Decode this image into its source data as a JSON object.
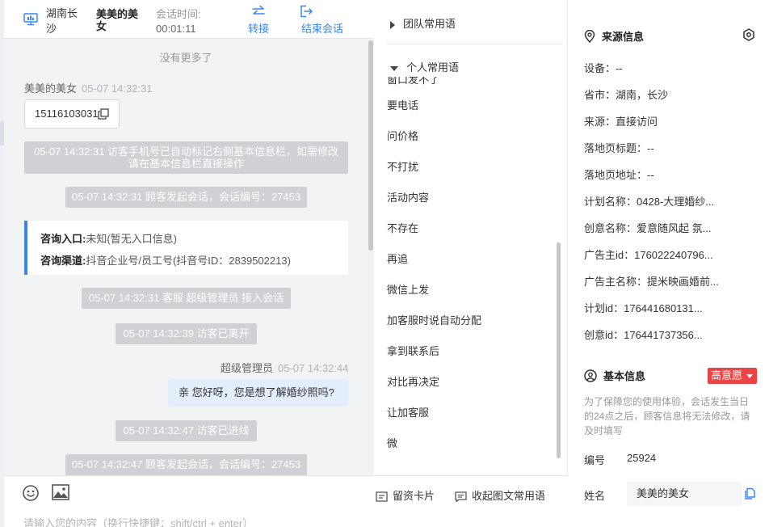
{
  "colors": {
    "accent": "#3a85f0",
    "badge": "#e84646",
    "system_msg_bg": "#cfd1d5",
    "chat_bg": "#f2f3f5"
  },
  "header": {
    "location": "湖南长沙",
    "visitor_name": "美美的美女",
    "session_time_label": "会话时间:",
    "session_time_value": "00:01:11",
    "transfer_label": "转接",
    "end_label": "结束会话"
  },
  "messages": {
    "no_more": "没有更多了",
    "visitor_name": "美美的美女",
    "visitor_time": "05-07 14:32:31",
    "phone": "15116103031",
    "sys_phone_mark_line1": "05-07 14:32:31 访客手机号已自动标记右侧基本信息栏，如需修改",
    "sys_phone_mark_line2": "请在基本信息栏直接操作",
    "sys_session_start_1": "05-07 14:32:31 顾客发起会话，会话编号：27453",
    "entry_label": "咨询入口:",
    "entry_value": "未知(暂无入口信息)",
    "channel_label": "咨询渠道:",
    "channel_value": "抖音企业号/员工号(抖音号ID：2839502213)",
    "sys_agent_join": "05-07 14:32:31 客服 超级管理员 接入会话",
    "sys_visitor_left": "05-07 14:32:39 访客已离开",
    "agent_name": "超级管理员",
    "agent_time": "05-07 14:32:44",
    "agent_message": "亲 您好呀，您是想了解婚纱照吗?",
    "sys_visitor_enter": "05-07 14:32:47 访客已进线",
    "sys_session_start_2": "05-07 14:32:47 顾客发起会话，会话编号：27453"
  },
  "composer": {
    "placeholder": "请输入您的内容（换行快捷键：shift/ctrl + enter）",
    "card_tool": "留资卡片",
    "fav_tool": "收起图文常用语"
  },
  "phrases": {
    "team_group": "团队常用语",
    "personal_group": "个人常用语",
    "clipped_item": "窗口发不了",
    "items": [
      "要电话",
      "问价格",
      "不打扰",
      "活动内容",
      "不存在",
      "再追",
      "微信上发",
      "加客服时说自动分配",
      "拿到联系后",
      "对比再决定",
      "让加客服",
      "微"
    ]
  },
  "source_info": {
    "title": "来源信息",
    "rows": [
      "设备：--",
      "省市：湖南，长沙",
      "来源：直接访问",
      "落地页标题：--",
      "落地页地址：--",
      "计划名称：0428-大理婚纱...",
      "创意名称：爱意随风起 氛...",
      "广告主id：176022240796...",
      "广告主名称：提米映画婚前...",
      "计划id：176441680131...",
      "创意id：176441737356..."
    ]
  },
  "basic_info": {
    "title": "基本信息",
    "intent_badge": "高意愿",
    "notice": "为了保障您的使用体验，会话发生当日的24点之后，顾客信息将无法修改，请及时填写",
    "id_label": "编号",
    "id_value": "25924",
    "name_label": "姓名",
    "name_value": "美美的美女"
  }
}
